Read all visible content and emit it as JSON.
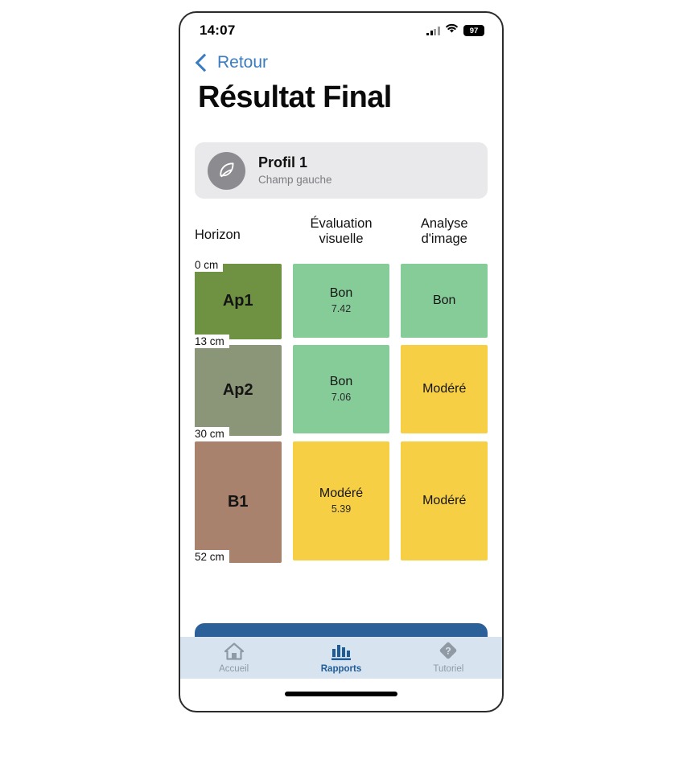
{
  "status_bar": {
    "time": "14:07",
    "battery_level": "97",
    "signal_icon": "cellular-signal-icon",
    "wifi_icon": "wifi-icon",
    "battery_icon": "battery-icon"
  },
  "nav": {
    "back_label": "Retour",
    "back_icon": "chevron-left-icon",
    "accent_color": "#3a7cc0"
  },
  "page": {
    "title": "Résultat Final"
  },
  "profile": {
    "icon": "leaf-icon",
    "name": "Profil 1",
    "subtitle": "Champ gauche",
    "avatar_color": "#8b8b90",
    "card_color": "#e9e9eb"
  },
  "table": {
    "headers": [
      "Horizon",
      "Évaluation visuelle",
      "Analyse d'image"
    ],
    "depth_marks": [
      "0 cm",
      "13 cm",
      "30 cm",
      "52 cm"
    ],
    "rows": [
      {
        "horizon": "Ap1",
        "horizon_color": "#6e9142",
        "visual": {
          "label": "Bon",
          "value": "7.42",
          "color": "#86cc98"
        },
        "image": {
          "label": "Bon",
          "value": "",
          "color": "#86cc98"
        }
      },
      {
        "horizon": "Ap2",
        "horizon_color": "#8b9678",
        "visual": {
          "label": "Bon",
          "value": "7.06",
          "color": "#86cc98"
        },
        "image": {
          "label": "Modéré",
          "value": "",
          "color": "#f7cf45"
        }
      },
      {
        "horizon": "B1",
        "horizon_color": "#a8826c",
        "visual": {
          "label": "Modéré",
          "value": "5.39",
          "color": "#f7cf45"
        },
        "image": {
          "label": "Modéré",
          "value": "",
          "color": "#f7cf45"
        }
      }
    ]
  },
  "primary_button": {
    "color": "#2b6099"
  },
  "tabbar": {
    "background": "#d7e4f0",
    "active_color": "#1f5c96",
    "inactive_color": "#8f9aa5",
    "tabs": [
      {
        "label": "Accueil",
        "icon": "home-icon",
        "active": false
      },
      {
        "label": "Rapports",
        "icon": "bar-chart-icon",
        "active": true
      },
      {
        "label": "Tutoriel",
        "icon": "question-diamond-icon",
        "active": false
      }
    ]
  }
}
